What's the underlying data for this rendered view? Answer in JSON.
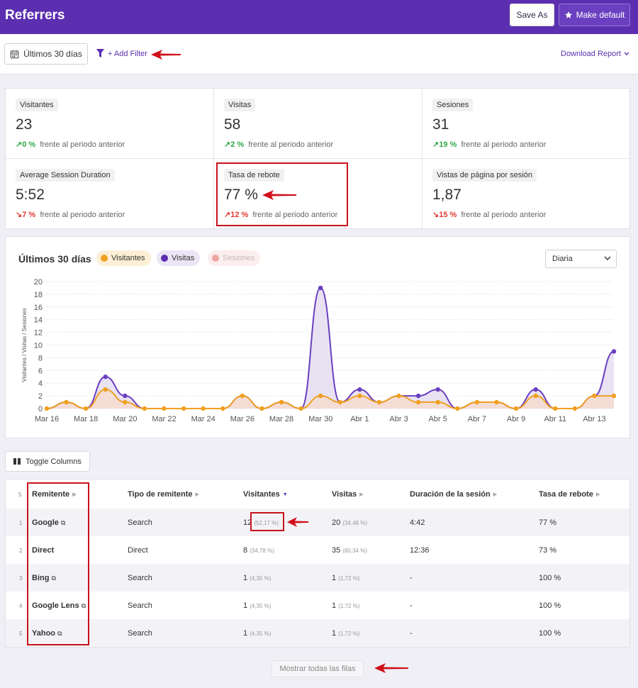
{
  "header": {
    "title": "Referrers",
    "save_as": "Save As",
    "make_default": "Make default"
  },
  "filterbar": {
    "date_range": "Últimos 30 días",
    "add_filter": "+ Add Filter",
    "download": "Download Report"
  },
  "metrics": [
    {
      "label": "Visitantes",
      "value": "23",
      "change": "0 %",
      "direction": "up",
      "suffix": "frente al periodo anterior"
    },
    {
      "label": "Visitas",
      "value": "58",
      "change": "2 %",
      "direction": "up",
      "suffix": "frente al periodo anterior"
    },
    {
      "label": "Sesiones",
      "value": "31",
      "change": "19 %",
      "direction": "up",
      "suffix": "frente al periodo anterior"
    },
    {
      "label": "Average Session Duration",
      "value": "5:52",
      "change": "7 %",
      "direction": "down",
      "suffix": "frente al periodo anterior"
    },
    {
      "label": "Tasa de rebote",
      "value": "77 %",
      "change": "12 %",
      "direction": "up-red",
      "suffix": "frente al periodo anterior"
    },
    {
      "label": "Vistas de página por sesión",
      "value": "1,87",
      "change": "15 %",
      "direction": "down",
      "suffix": "frente al periodo anterior"
    }
  ],
  "chart": {
    "title": "Últimos 30 días",
    "legend": [
      {
        "label": "Visitantes",
        "color": "#f0a020",
        "bg": "#fcefd6"
      },
      {
        "label": "Visitas",
        "color": "#5b2fb0",
        "bg": "#ebe5f6"
      },
      {
        "label": "Sesiones",
        "color": "#f0a6a0",
        "bg": "#fbeeee"
      }
    ],
    "interval": "Diaria"
  },
  "chart_data": {
    "type": "line",
    "ylabel": "Visitantes / Visitas / Sesiones",
    "ylim": [
      0,
      20
    ],
    "yticks": [
      "0",
      "2",
      "4",
      "6",
      "8",
      "10",
      "12",
      "14",
      "16",
      "18",
      "20"
    ],
    "x": [
      "Mar 16",
      "Mar 17",
      "Mar 18",
      "Mar 19",
      "Mar 20",
      "Mar 21",
      "Mar 22",
      "Mar 23",
      "Mar 24",
      "Mar 25",
      "Mar 26",
      "Mar 27",
      "Mar 28",
      "Mar 29",
      "Mar 30",
      "Mar 31",
      "Abr 1",
      "Abr 2",
      "Abr 3",
      "Abr 4",
      "Abr 5",
      "Abr 6",
      "Abr 7",
      "Abr 8",
      "Abr 9",
      "Abr 10",
      "Abr 11",
      "Abr 12",
      "Abr 13",
      "Abr 14"
    ],
    "xticks": [
      "Mar 16",
      "Mar 18",
      "Mar 20",
      "Mar 22",
      "Mar 24",
      "Mar 26",
      "Mar 28",
      "Mar 30",
      "Abr 1",
      "Abr 3",
      "Abr 5",
      "Abr 7",
      "Abr 9",
      "Abr 11",
      "Abr 13"
    ],
    "series": [
      {
        "name": "Visitas",
        "color": "#6a3fc0",
        "values": [
          0,
          1,
          0,
          5,
          2,
          0,
          0,
          0,
          0,
          0,
          2,
          0,
          1,
          0,
          19,
          1,
          3,
          1,
          2,
          2,
          3,
          0,
          1,
          1,
          0,
          3,
          0,
          0,
          2,
          9
        ]
      },
      {
        "name": "Visitantes",
        "color": "#f0a020",
        "values": [
          0,
          1,
          0,
          3,
          1,
          0,
          0,
          0,
          0,
          0,
          2,
          0,
          1,
          0,
          2,
          1,
          2,
          1,
          2,
          1,
          1,
          0,
          1,
          1,
          0,
          2,
          0,
          0,
          2,
          2
        ]
      }
    ]
  },
  "toggle_columns": "Toggle Columns",
  "table": {
    "count": "5",
    "columns": [
      "Remitente",
      "Tipo de remitente",
      "Visitantes",
      "Visitas",
      "Duración de la sesión",
      "Tasa de rebote"
    ],
    "rows": [
      {
        "rank": "1",
        "name": "Google",
        "type": "Search",
        "visitors": "12",
        "visitors_pct": "(52,17 %)",
        "visits": "20",
        "visits_pct": "(34,48 %)",
        "duration": "4:42",
        "bounce": "77 %"
      },
      {
        "rank": "2",
        "name": "Direct",
        "type": "Direct",
        "visitors": "8",
        "visitors_pct": "(34,78 %)",
        "visits": "35",
        "visits_pct": "(60,34 %)",
        "duration": "12:36",
        "bounce": "73 %"
      },
      {
        "rank": "3",
        "name": "Bing",
        "type": "Search",
        "visitors": "1",
        "visitors_pct": "(4,35 %)",
        "visits": "1",
        "visits_pct": "(1,72 %)",
        "duration": "-",
        "bounce": "100 %"
      },
      {
        "rank": "4",
        "name": "Google Lens",
        "type": "Search",
        "visitors": "1",
        "visitors_pct": "(4,35 %)",
        "visits": "1",
        "visits_pct": "(1,72 %)",
        "duration": "-",
        "bounce": "100 %"
      },
      {
        "rank": "5",
        "name": "Yahoo",
        "type": "Search",
        "visitors": "1",
        "visitors_pct": "(4,35 %)",
        "visits": "1",
        "visits_pct": "(1,72 %)",
        "duration": "-",
        "bounce": "100 %"
      }
    ]
  },
  "show_all": "Mostrar todas las filas"
}
